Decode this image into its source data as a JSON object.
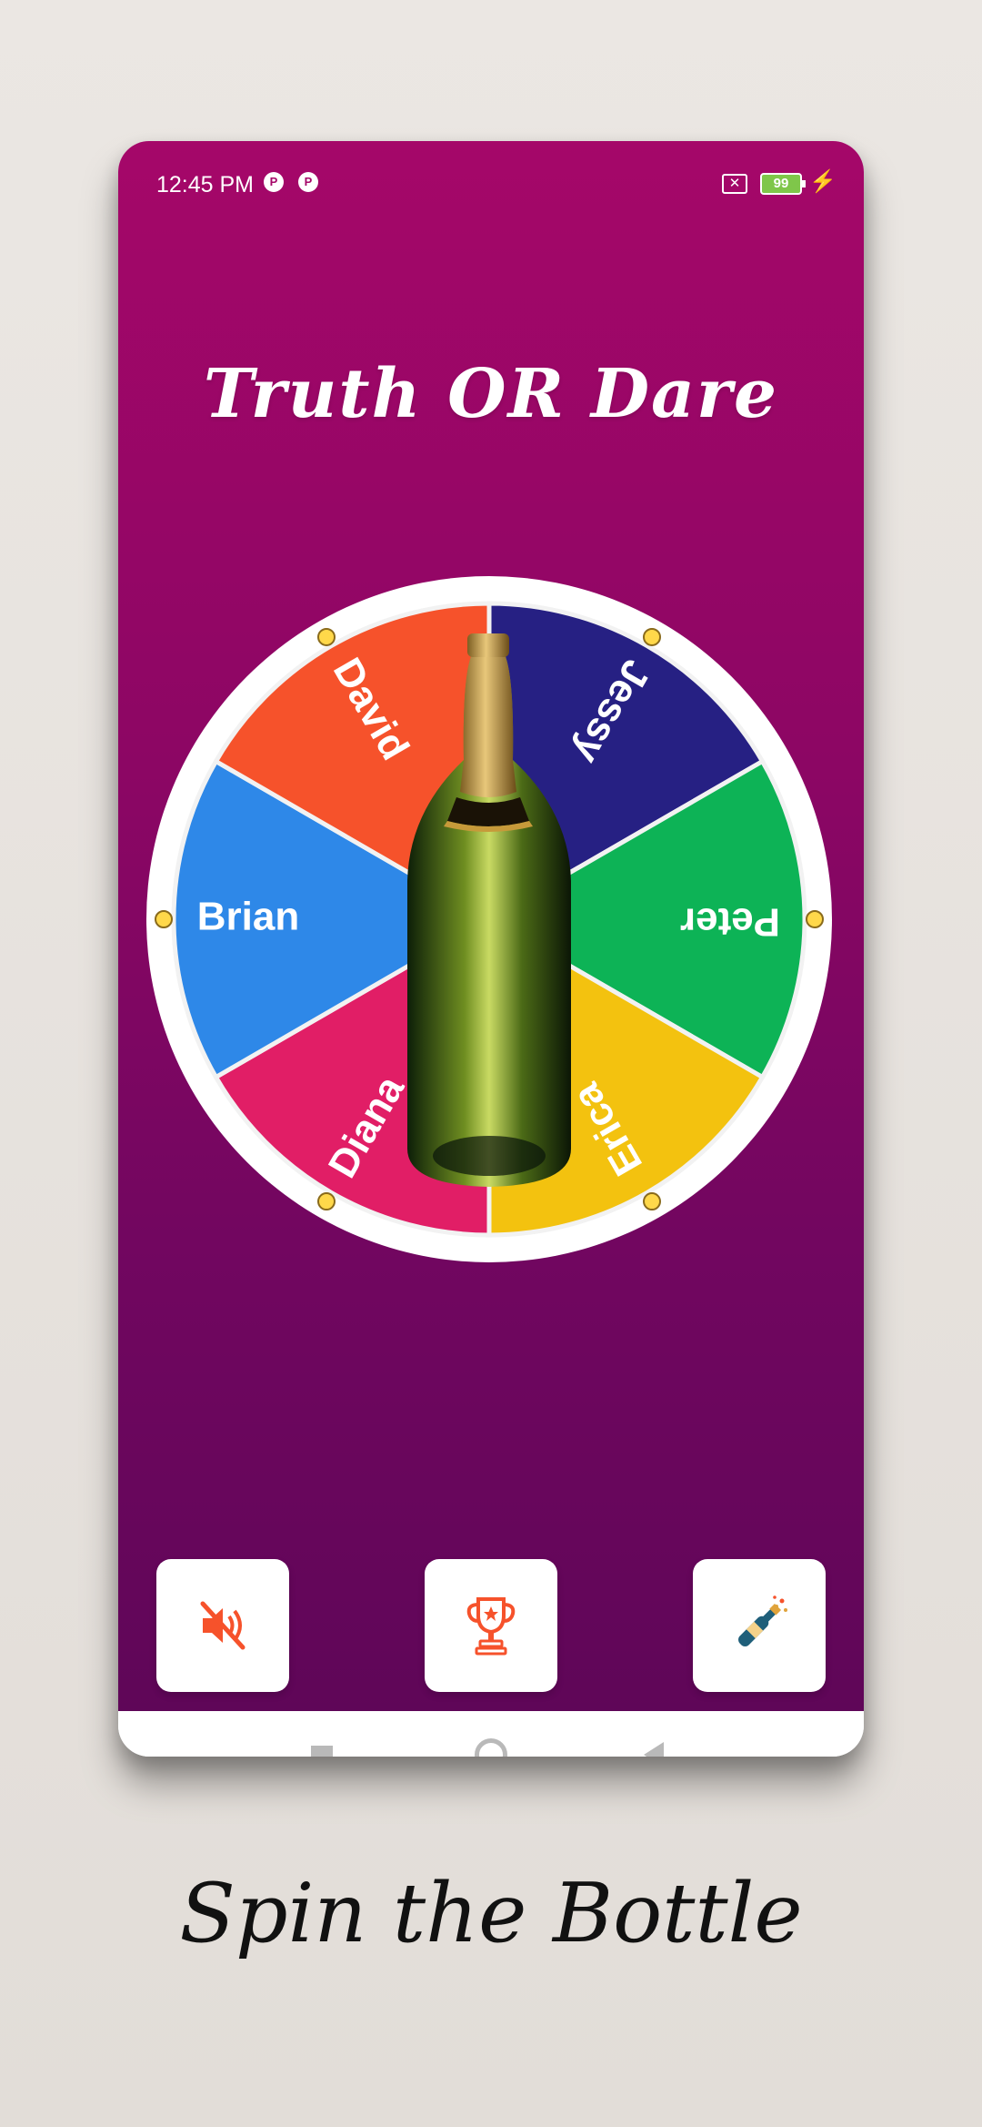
{
  "status_bar": {
    "time": "12:45 PM",
    "notif_icon_1": "P",
    "notif_icon_2": "P",
    "battery": "99",
    "icons": [
      "sim-off-icon",
      "battery-icon",
      "charging-bolt-icon"
    ]
  },
  "app_title": "Truth OR Dare",
  "wheel": {
    "segments": [
      {
        "name": "Jessy",
        "color": "#262083"
      },
      {
        "name": "Peter",
        "color": "#0db356"
      },
      {
        "name": "Erica",
        "color": "#f3c20f"
      },
      {
        "name": "Diana",
        "color": "#e11e66"
      },
      {
        "name": "Brian",
        "color": "#2e88e8"
      },
      {
        "name": "David",
        "color": "#f6522b"
      }
    ],
    "center_icon": "bottle-icon"
  },
  "buttons": [
    {
      "id": "mute",
      "icon": "mute-icon"
    },
    {
      "id": "trophy",
      "icon": "trophy-icon"
    },
    {
      "id": "bottle",
      "icon": "champagne-icon"
    }
  ],
  "accent_color": "#f6522b",
  "tagline": "Spin the Bottle"
}
